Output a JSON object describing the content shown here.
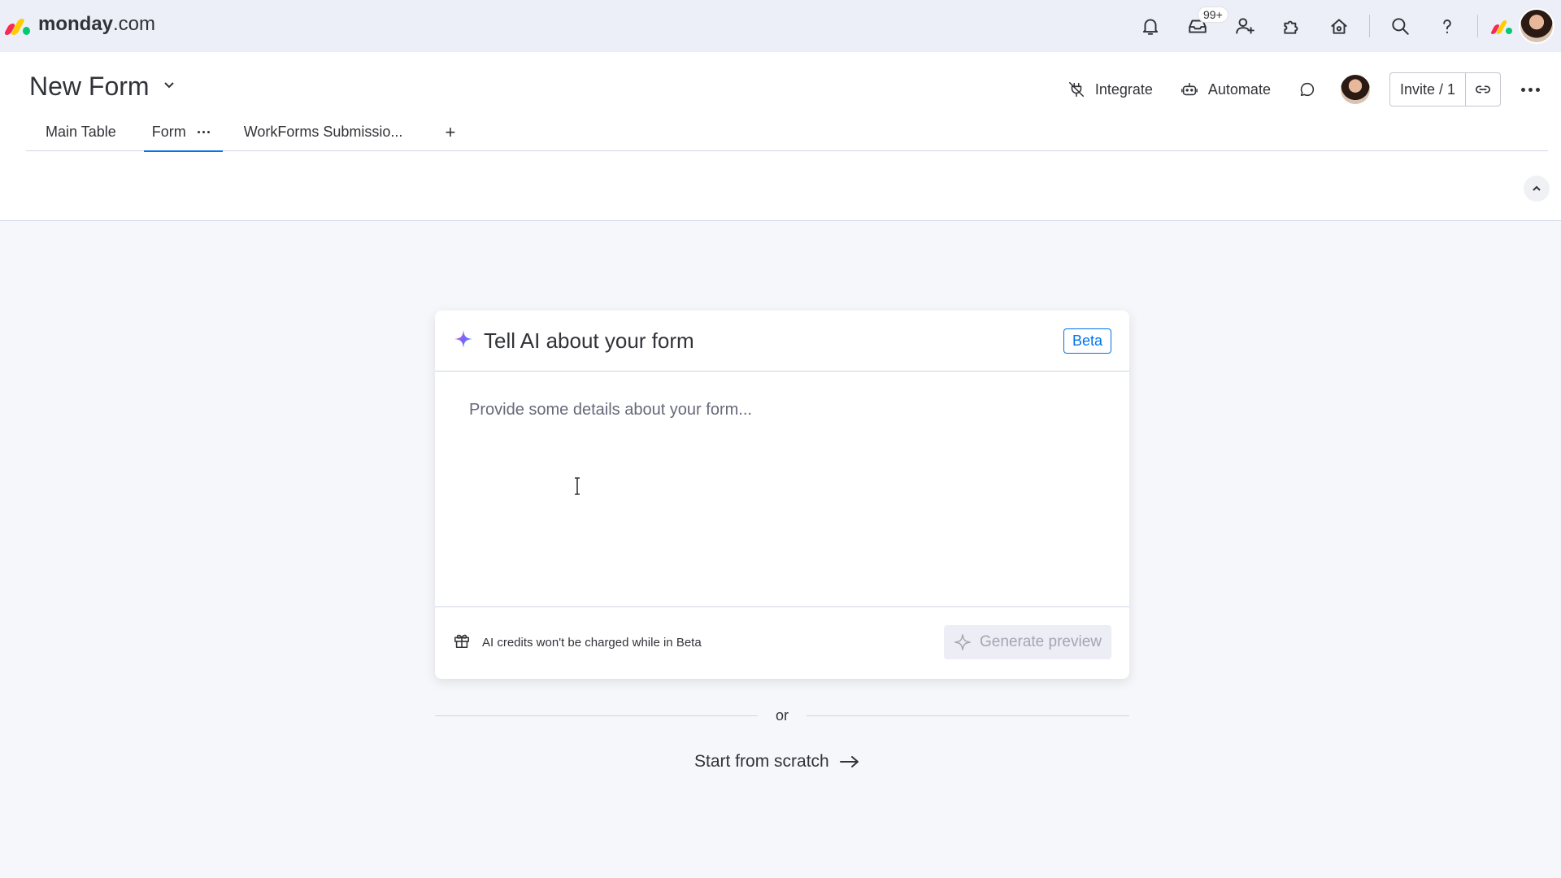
{
  "brand": {
    "name_bold": "monday",
    "name_suffix": ".com",
    "colors": [
      "#f62b54",
      "#ffcc00",
      "#00ca72"
    ]
  },
  "topbar": {
    "icons": [
      "bell-icon",
      "inbox-icon",
      "invite-member-icon",
      "puzzle-icon",
      "marketplace-icon",
      "search-icon",
      "help-icon"
    ],
    "inbox_badge": "99+"
  },
  "board": {
    "title": "New Form",
    "actions": {
      "integrate": "Integrate",
      "automate": "Automate",
      "invite": "Invite / 1"
    },
    "tabs": [
      {
        "label": "Main Table"
      },
      {
        "label": "Form"
      },
      {
        "label": "WorkForms Submissio..."
      }
    ],
    "tab_add": "+"
  },
  "ai_card": {
    "title": "Tell AI about your form",
    "badge": "Beta",
    "placeholder": "Provide some details about your form...",
    "credits_note": "AI credits won't be charged while in Beta",
    "generate_label": "Generate preview"
  },
  "divider_text": "or",
  "start_scratch": "Start from scratch",
  "accent_color": "#0073ea"
}
